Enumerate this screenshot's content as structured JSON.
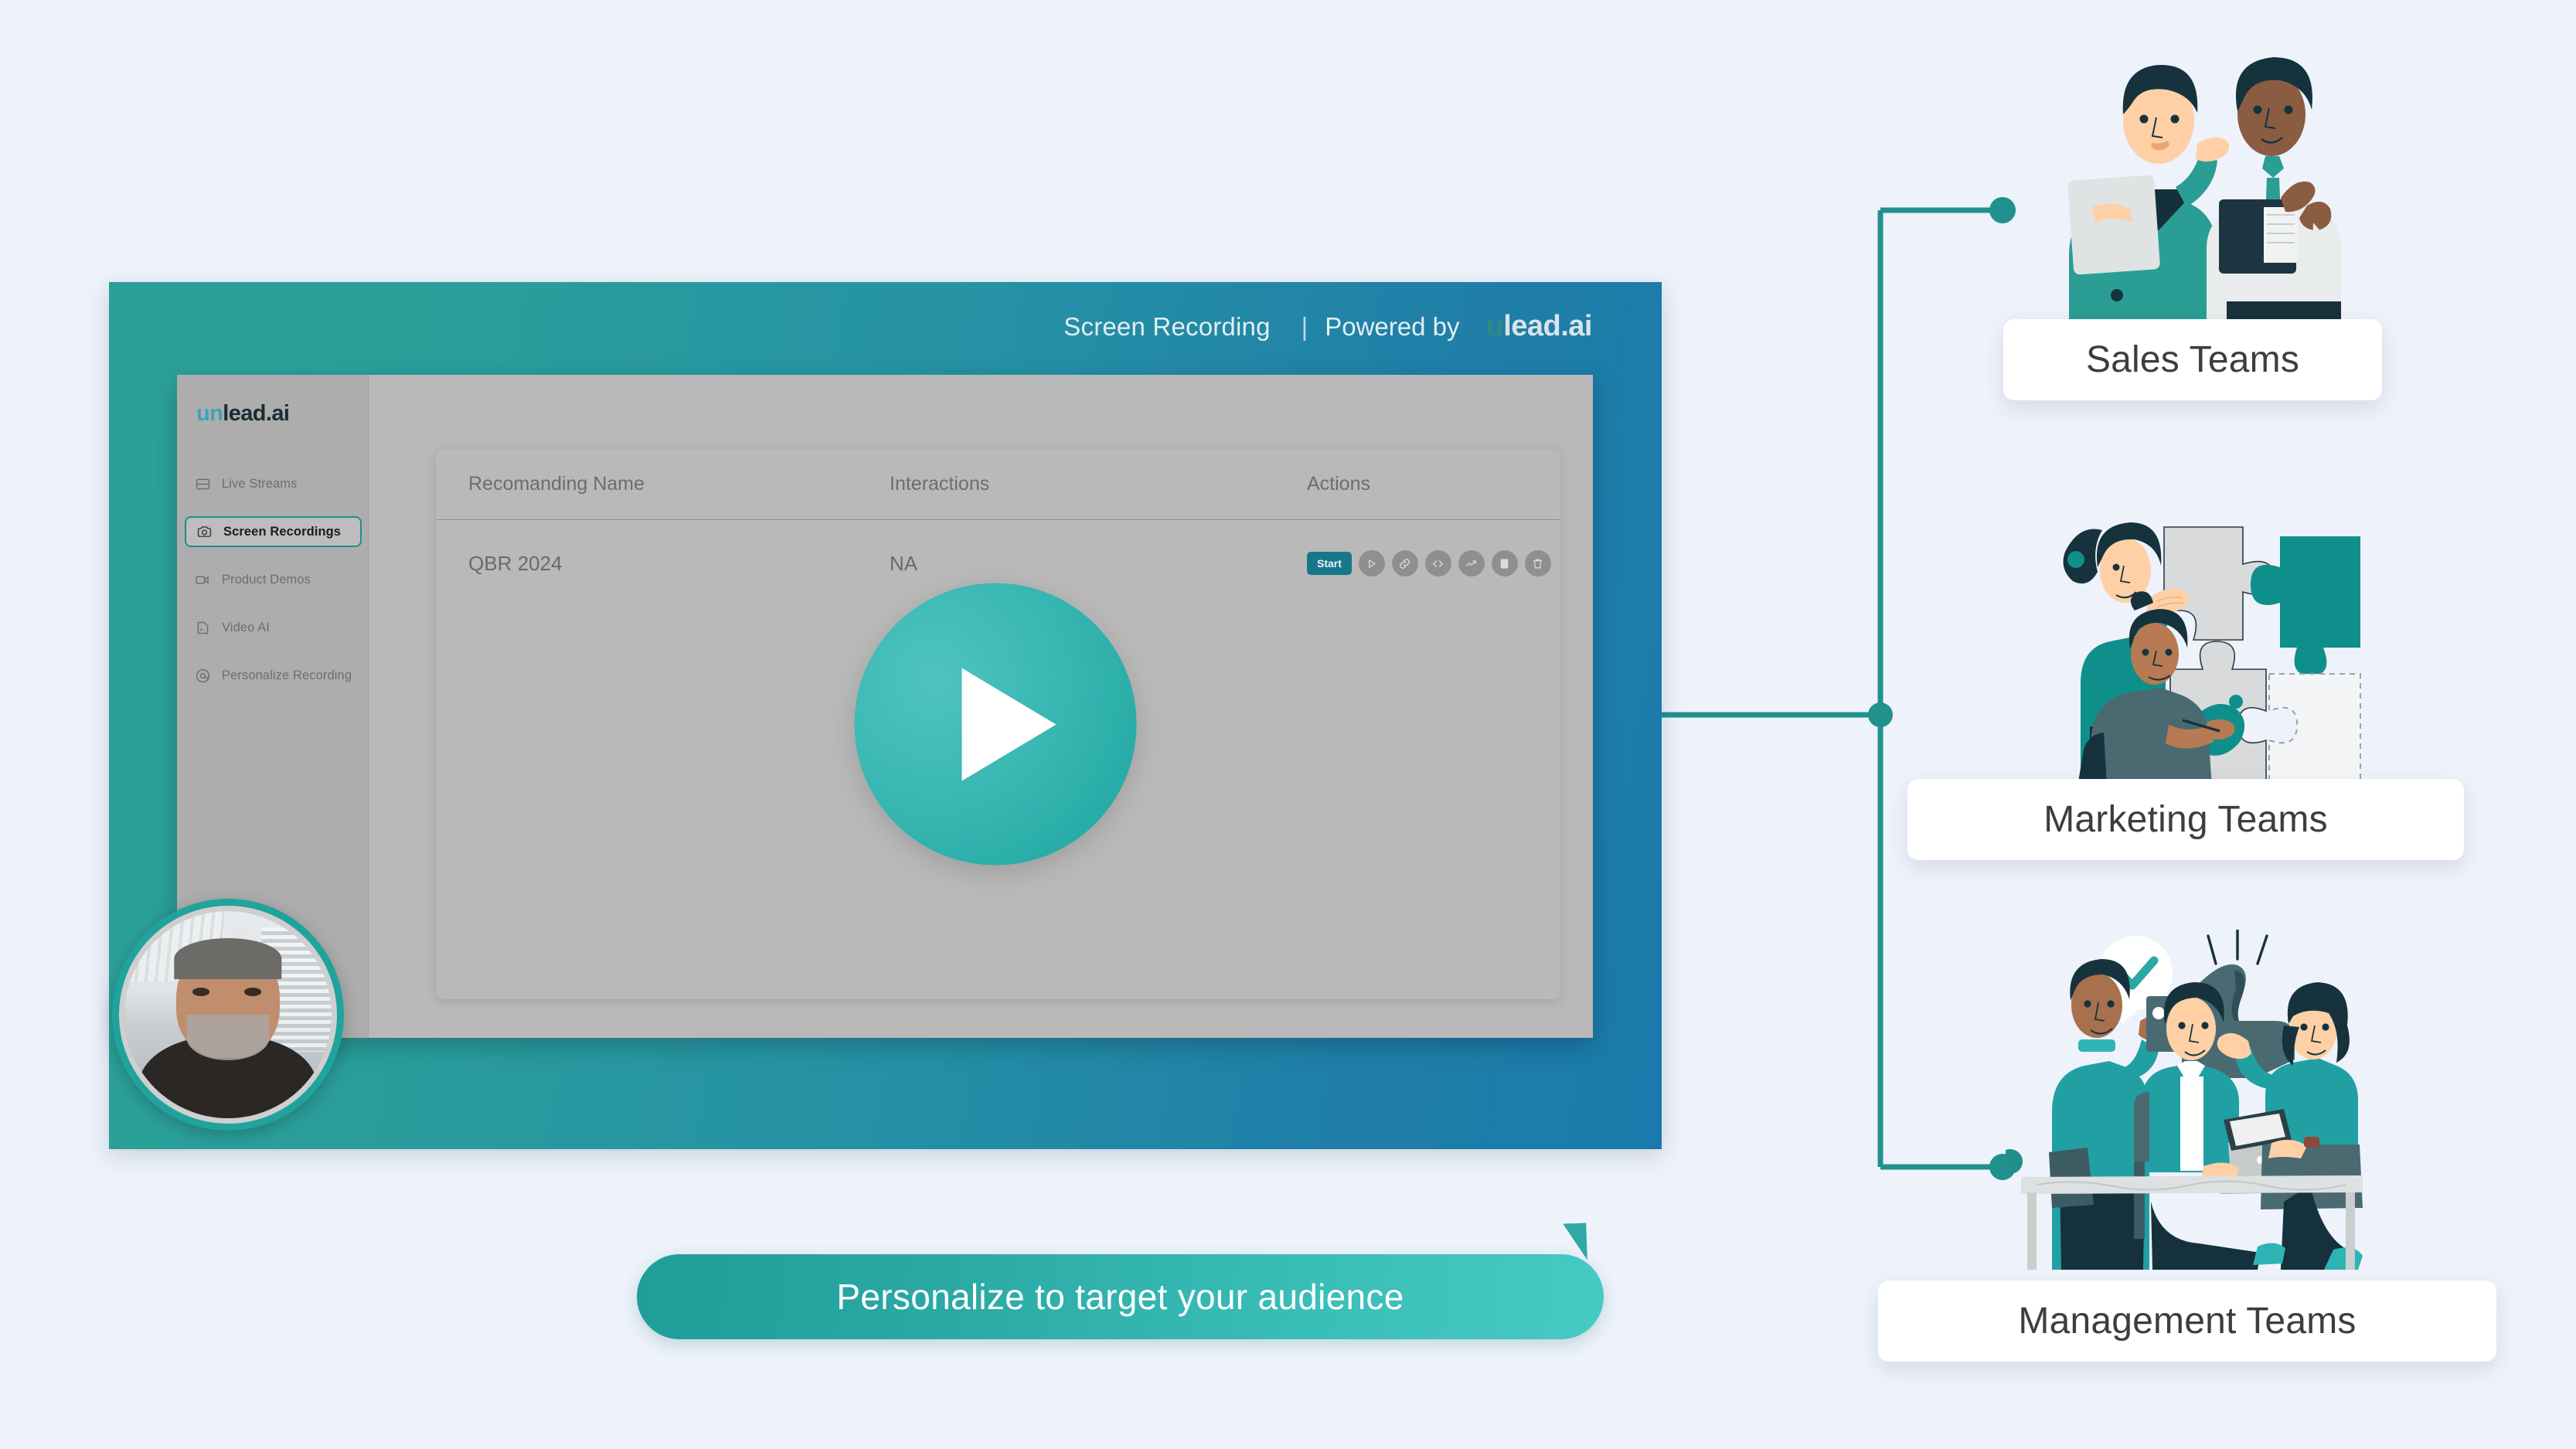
{
  "page": {
    "background_color": "#eef2fa",
    "accent_teal": "#1f9d99",
    "accent_blue": "#1a7aab"
  },
  "dashboard": {
    "topbar": {
      "title": "Screen Recording",
      "divider": "|",
      "powered_by": "Powered by",
      "logo_u": "u",
      "logo_rest": "lead.ai"
    },
    "app_logo": {
      "u": "un",
      "rest": "lead.ai"
    },
    "sidebar": {
      "items": [
        {
          "label": "Live Streams",
          "icon": "layout-rows-icon",
          "active": false
        },
        {
          "label": "Screen Recordings",
          "icon": "camera-icon",
          "active": true
        },
        {
          "label": "Product Demos",
          "icon": "video-camera-icon",
          "active": false
        },
        {
          "label": "Video AI",
          "icon": "video-ai-icon",
          "active": false
        },
        {
          "label": "Personalize Recording",
          "icon": "at-circle-icon",
          "active": false
        }
      ]
    },
    "table": {
      "columns": [
        "Recomanding Name",
        "Interactions",
        "Actions"
      ],
      "rows": [
        {
          "name": "QBR 2024",
          "interactions": "NA",
          "actions": {
            "start_label": "Start",
            "icons": [
              "play-icon",
              "link-icon",
              "code-icon",
              "trending-up-icon",
              "clipboard-icon",
              "trash-icon"
            ]
          }
        }
      ]
    },
    "player": {
      "play_icon": "play-triangle-icon"
    },
    "webcam": {
      "presenter_alt": "presenter-webcam-thumbnail"
    }
  },
  "caption": {
    "text": "Personalize to target your audience"
  },
  "audiences": [
    {
      "label": "Sales Teams",
      "illustration": "two-colleagues-talking-illustration"
    },
    {
      "label": "Marketing Teams",
      "illustration": "two-people-assembling-puzzle-illustration"
    },
    {
      "label": "Management Teams",
      "illustration": "team-thumbs-up-meeting-illustration"
    }
  ]
}
